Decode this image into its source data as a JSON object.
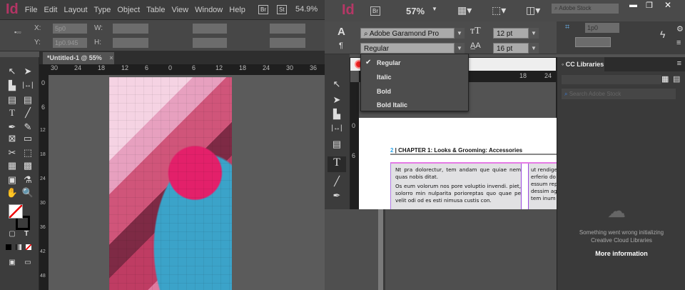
{
  "left_window": {
    "menu": [
      "File",
      "Edit",
      "Layout",
      "Type",
      "Object",
      "Table",
      "View",
      "Window",
      "Help"
    ],
    "bridge_badge": "Br",
    "stock_badge": "St",
    "zoom": "54.9%",
    "control": {
      "x_label": "X:",
      "x_value": "5p0",
      "y_label": "Y:",
      "y_value": "1p0.945",
      "w_label": "W:",
      "h_label": "H:"
    },
    "doc_tab": "*Untitled-1 @ 55%",
    "doc_tab_close": "×",
    "ruler_h": [
      "30",
      "24",
      "18",
      "12",
      "6",
      "0",
      "6",
      "12",
      "18",
      "24",
      "30",
      "36"
    ],
    "ruler_v": [
      "0",
      "6",
      "12",
      "18",
      "24",
      "30",
      "36",
      "42",
      "48"
    ]
  },
  "right_window": {
    "logo": "Id",
    "bridge_badge": "Br",
    "zoom": "57%",
    "stock_search_placeholder": "Adobe Stock",
    "font_family": "Adobe Garamond Pro",
    "font_style": "Regular",
    "font_size": "12 pt",
    "leading": "16 pt",
    "stroke_value": "1p0",
    "style_menu": [
      {
        "label": "Regular",
        "checked": true
      },
      {
        "label": "Italic",
        "checked": false
      },
      {
        "label": "Bold",
        "checked": false
      },
      {
        "label": "Bold Italic",
        "checked": false
      }
    ],
    "ruler_h": [
      "18",
      "24"
    ],
    "ruler_v": [
      "0",
      "6"
    ],
    "page": {
      "page_number": "2",
      "header": "CHAPTER 1: Looks & Grooming: Accessories",
      "col1": [
        "Nt pra dolorectur, tem andam que quiae nem quas nobis ditat.",
        "Os eum volorum nos pore voluptio invendi. piet, solorro min nulparita porioreptas quo quae pe velit odi od es esti nimusa custis con."
      ],
      "col2": [
        "ut rendige",
        "erferio do",
        "essum rep",
        "dessim ag",
        "tem inum"
      ]
    }
  },
  "cc_libraries": {
    "title": "CC Libraries",
    "search_placeholder": "Search Adobe Stock",
    "error": "Something went wrong initializing Creative Cloud Libraries",
    "more_info": "More information"
  }
}
